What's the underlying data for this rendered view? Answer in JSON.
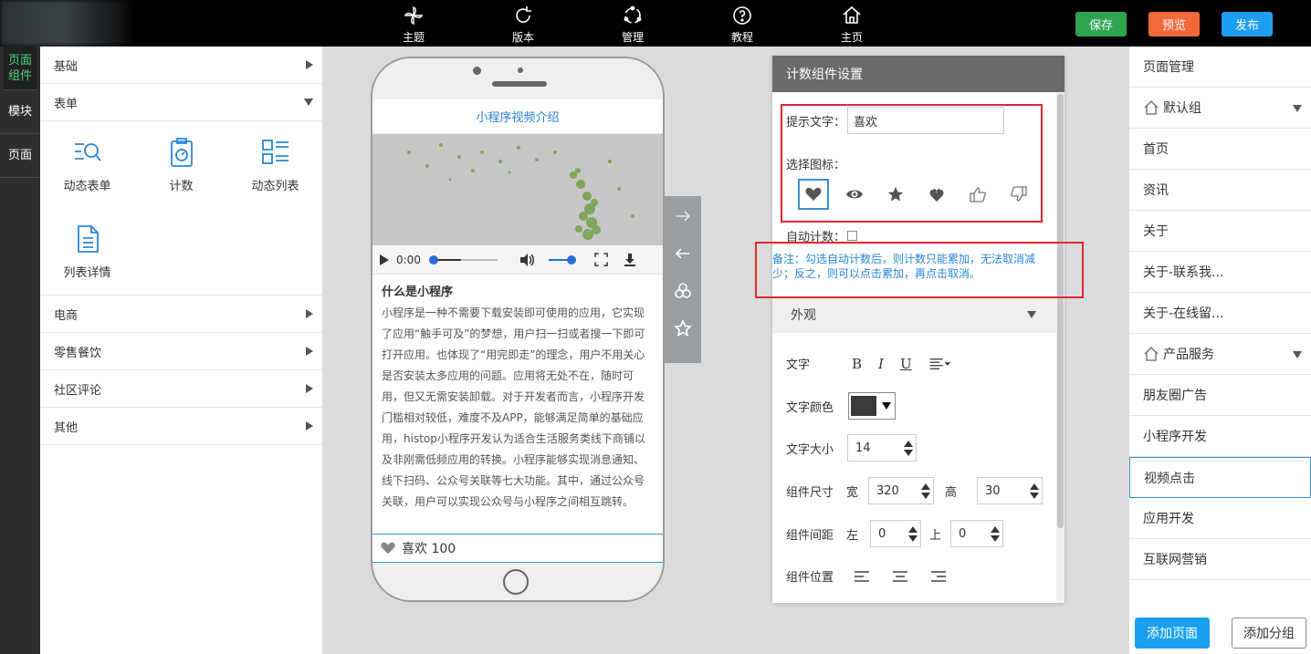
{
  "topbar": {
    "nav": [
      {
        "label": "主题",
        "icon": "pinwheel-icon"
      },
      {
        "label": "版本",
        "icon": "refresh-icon"
      },
      {
        "label": "管理",
        "icon": "circle-dots-icon"
      },
      {
        "label": "教程",
        "icon": "question-icon"
      },
      {
        "label": "主页",
        "icon": "home-icon"
      }
    ],
    "save_label": "保存",
    "preview_label": "预览",
    "publish_label": "发布",
    "colors": {
      "save": "#2ea44f",
      "preview": "#f2693c",
      "publish": "#1e9ef0"
    }
  },
  "left_tabs": [
    {
      "label": "页面组件",
      "active": true
    },
    {
      "label": "模块"
    },
    {
      "label": "页面"
    }
  ],
  "components": {
    "basic": "基础",
    "form": "表单",
    "form_items": [
      {
        "label": "动态表单",
        "icon": "search-list-icon"
      },
      {
        "label": "计数",
        "icon": "counter-icon"
      },
      {
        "label": "动态列表",
        "icon": "grid-list-icon"
      },
      {
        "label": "列表详情",
        "icon": "document-icon"
      }
    ],
    "categories": [
      "电商",
      "零售餐饮",
      "社区评论",
      "其他"
    ]
  },
  "phone": {
    "title": "小程序视频介绍",
    "video_time": "0:00",
    "article_title": "什么是小程序",
    "article_body": "小程序是一种不需要下载安装即可使用的应用，它实现了应用“触手可及”的梦想，用户扫一扫或者搜一下即可打开应用。也体现了“用完即走”的理念，用户不用关心是否安装太多应用的问题。应用将无处不在，随时可用，但又无需安装卸载。对于开发者而言，小程序开发门槛相对较低，难度不及APP，能够满足简单的基础应用，histop小程序开发认为适合生活服务类线下商铺以及非刚需低频应用的转换。小程序能够实现消息通知、线下扫码、公众号关联等七大功能。其中，通过公众号关联，用户可以实现公众号与小程序之间相互跳转。",
    "like_text": "喜欢 100"
  },
  "settings": {
    "title": "计数组件设置",
    "hint_label": "提示文字：",
    "hint_value": "喜欢",
    "icon_label": "选择图标：",
    "icons": [
      "heart-icon",
      "eye-icon",
      "star-icon",
      "flower-heart-icon",
      "thumbs-up-icon",
      "thumbs-down-icon"
    ],
    "auto_label": "自动计数：",
    "note": "备注：勾选自动计数后，则计数只能累加，无法取消减少；反之，则可以点击累加，再点击取消。",
    "appearance": "外观",
    "text_label": "文字",
    "text_color_label": "文字颜色",
    "font_size_label": "文字大小",
    "font_size": "14",
    "size_label": "组件尺寸",
    "width_label": "宽",
    "width_value": "320",
    "height_label": "高",
    "height_value": "30",
    "spacing_label": "组件间距",
    "left_label": "左",
    "left_value": "0",
    "top_label": "上",
    "top_value": "0",
    "position_label": "组件位置"
  },
  "pages": {
    "title": "页面管理",
    "items": [
      {
        "label": "默认组",
        "group": true
      },
      {
        "label": "首页"
      },
      {
        "label": "资讯"
      },
      {
        "label": "关于"
      },
      {
        "label": "关于-联系我..."
      },
      {
        "label": "关于-在线留..."
      },
      {
        "label": "产品服务",
        "group": true
      },
      {
        "label": "朋友圈广告"
      },
      {
        "label": "小程序开发"
      },
      {
        "label": "视频点击",
        "active": true
      },
      {
        "label": "应用开发"
      },
      {
        "label": "互联网营销"
      }
    ],
    "add_page": "添加页面",
    "add_group": "添加分组"
  }
}
